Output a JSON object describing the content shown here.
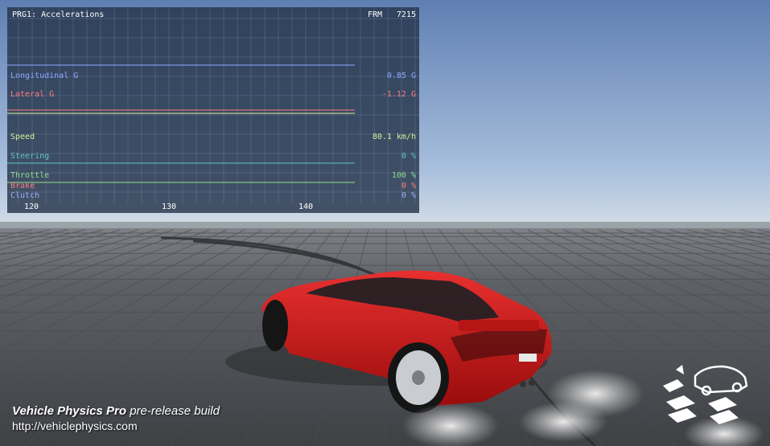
{
  "telemetry": {
    "title": "PRG1: Accelerations",
    "frame_label": "FRM",
    "frame_value": "7215",
    "x_ticks": [
      "120",
      "130",
      "140"
    ],
    "channels": [
      {
        "label": "Longitudinal G",
        "value": "0.85 G",
        "color": "#8fa8ff"
      },
      {
        "label": "Lateral G",
        "value": "-1.12 G",
        "color": "#ff7d7d"
      },
      {
        "label": "Speed",
        "value": "80.1 km/h",
        "color": "#d6ee99"
      },
      {
        "label": "Steering",
        "value": "0 %",
        "color": "#5ec4c4"
      },
      {
        "label": "Throttle",
        "value": "100 %",
        "color": "#8fe08f"
      },
      {
        "label": "Brake",
        "value": "0 %",
        "color": "#ff7d7d"
      },
      {
        "label": "Clutch",
        "value": "0 %",
        "color": "#9ab0ff"
      }
    ]
  },
  "caption": {
    "product": "Vehicle Physics Pro",
    "build": "pre-release build",
    "url": "http://vehiclephysics.com"
  }
}
